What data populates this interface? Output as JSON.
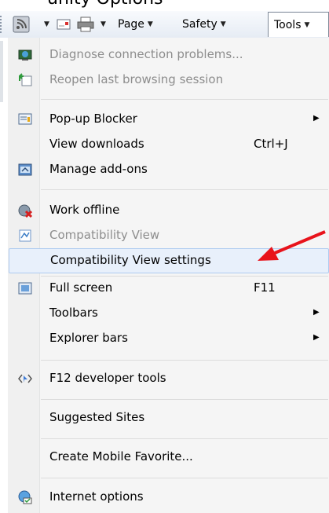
{
  "window": {
    "caption_partial": "unity Options",
    "toolbar": {
      "page_label": "Page",
      "safety_label": "Safety",
      "tools_label": "Tools"
    }
  },
  "tools_menu": {
    "items": [
      {
        "label": "Diagnose connection problems...",
        "icon": "network-diagnose-icon",
        "enabled": false
      },
      {
        "label": "Reopen last browsing session",
        "icon": "reopen-session-icon",
        "enabled": false
      },
      {
        "label": "Pop-up Blocker",
        "icon": "popup-blocker-icon",
        "submenu": true
      },
      {
        "label": "View downloads",
        "shortcut": "Ctrl+J"
      },
      {
        "label": "Manage add-ons",
        "icon": "addons-icon"
      },
      {
        "label": "Work offline",
        "icon": "work-offline-icon"
      },
      {
        "label": "Compatibility View",
        "icon": "compatibility-view-icon",
        "enabled": false
      },
      {
        "label": "Compatibility View settings",
        "highlighted": true
      },
      {
        "label": "Full screen",
        "icon": "fullscreen-icon",
        "shortcut": "F11"
      },
      {
        "label": "Toolbars",
        "submenu": true
      },
      {
        "label": "Explorer bars",
        "submenu": true
      },
      {
        "label": "F12 developer tools",
        "icon": "developer-tools-icon"
      },
      {
        "label": "Suggested Sites"
      },
      {
        "label": "Create Mobile Favorite..."
      },
      {
        "label": "Internet options",
        "icon": "internet-options-icon"
      }
    ]
  },
  "colors": {
    "annotation_arrow": "#e8131b",
    "highlight_bg": "#e8f0fb",
    "highlight_border": "#aecbf0"
  }
}
